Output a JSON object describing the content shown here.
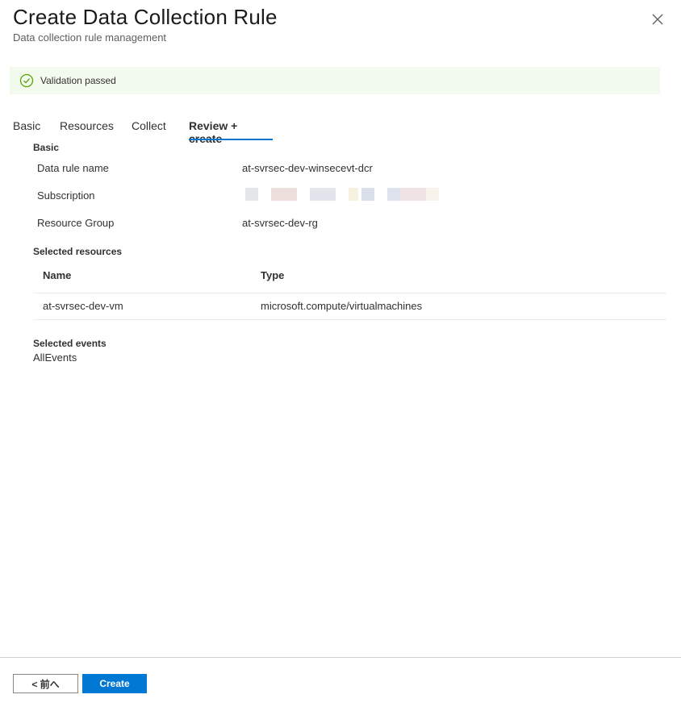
{
  "header": {
    "title": "Create Data Collection Rule",
    "subtitle": "Data collection rule management",
    "close_icon": "close-icon"
  },
  "banner": {
    "icon": "checkmark-circle-icon",
    "text": "Validation passed",
    "color": "#f3fbee",
    "icon_color": "#57a300"
  },
  "tabs": [
    {
      "label": "Basic"
    },
    {
      "label": "Resources"
    },
    {
      "label": "Collect"
    },
    {
      "label": "Review + create",
      "active": true
    }
  ],
  "basic": {
    "heading": "Basic",
    "fields": [
      {
        "label": "Data rule name",
        "value": "at-svrsec-dev-winsecevt-dcr"
      },
      {
        "label": "Subscription",
        "value": ""
      },
      {
        "label": "Resource Group",
        "value": "at-svrsec-dev-rg"
      }
    ]
  },
  "resources": {
    "heading": "Selected resources",
    "columns": [
      "Name",
      "Type"
    ],
    "rows": [
      [
        "at-svrsec-dev-vm",
        "microsoft.compute/virtualmachines"
      ]
    ]
  },
  "events": {
    "heading": "Selected events",
    "value": "AllEvents"
  },
  "footer": {
    "prev_label": "< 前へ",
    "create_label": "Create"
  },
  "colors": {
    "accent": "#0078d4",
    "text": "#323130"
  }
}
